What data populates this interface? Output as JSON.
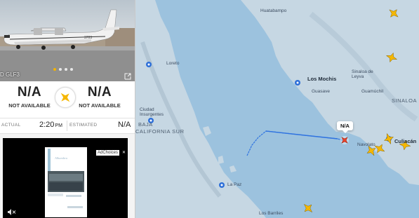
{
  "panel": {
    "registration": "D GLF3",
    "photo_dots": 4,
    "origin": {
      "code": "N/A",
      "name": "NOT AVAILABLE"
    },
    "destination": {
      "code": "N/A",
      "name": "NOT AVAILABLE"
    },
    "actual_label": "ACTUAL",
    "actual_time": "2:20",
    "actual_ampm": "PM",
    "estimated_label": "ESTIMATED",
    "estimated_time": "N/A"
  },
  "ad": {
    "choices_label": "AdChoices",
    "card_title": "Alhambra"
  },
  "map": {
    "labels": {
      "huatabampo": "Huatabampo",
      "loreto": "Loreto",
      "los_mochis": "Los Mochis",
      "sinaloa_de_leyva": "Sinaloa de Leyva",
      "guasave": "Guasave",
      "guamuchil": "Guamúchil",
      "ciudad_insurgentes": "Ciudad Insurgentes",
      "baja": "BAJA",
      "california_sur": "CALIFORNIA SUR",
      "la_paz": "La Paz",
      "navolato": "Navolato",
      "culiacan": "Culiacán",
      "los_barriles": "Los Barriles",
      "sinaloa": "SINALOA"
    },
    "selected_tag": "N/A"
  },
  "colors": {
    "sea": "#9cc2de",
    "land": "#c6d7e3",
    "track": "#2f73e0",
    "aircraft": "#f5b700"
  }
}
